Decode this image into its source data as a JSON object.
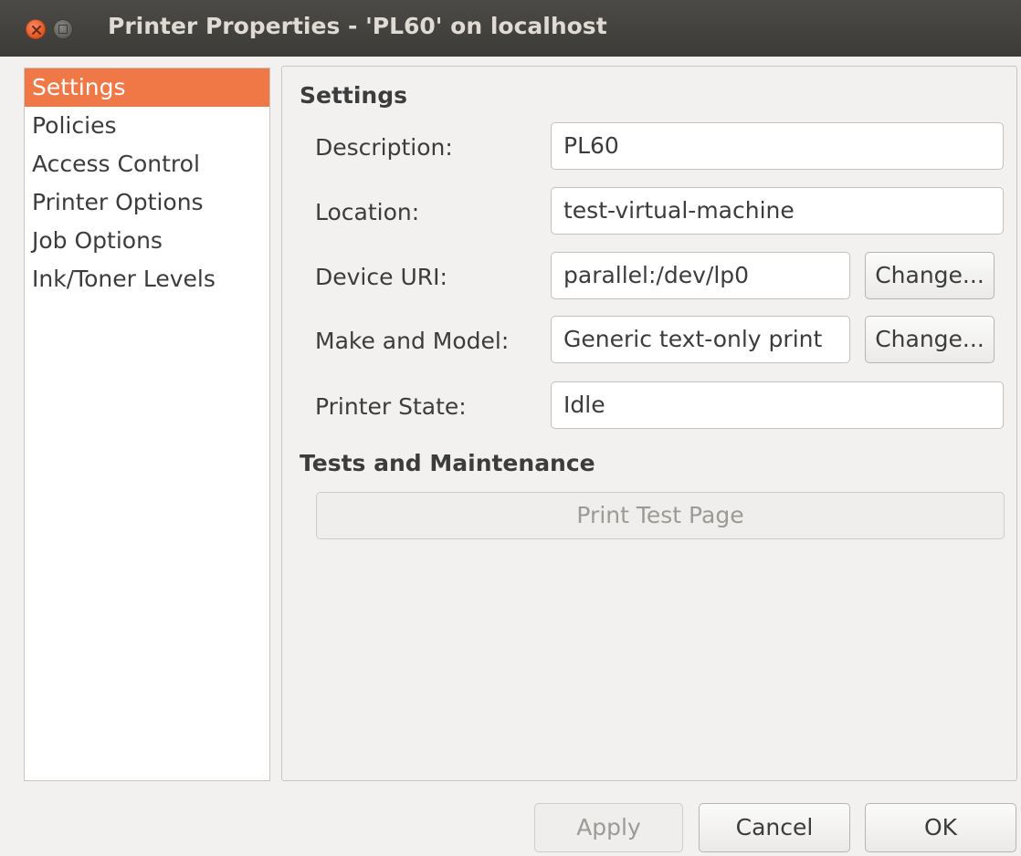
{
  "window": {
    "title": "Printer Properties - 'PL60' on localhost"
  },
  "sidebar": {
    "items": [
      {
        "label": "Settings",
        "active": true
      },
      {
        "label": "Policies",
        "active": false
      },
      {
        "label": "Access Control",
        "active": false
      },
      {
        "label": "Printer Options",
        "active": false
      },
      {
        "label": "Job Options",
        "active": false
      },
      {
        "label": "Ink/Toner Levels",
        "active": false
      }
    ]
  },
  "settings": {
    "heading": "Settings",
    "description": {
      "label": "Description:",
      "value": "PL60"
    },
    "location": {
      "label": "Location:",
      "value": "test-virtual-machine"
    },
    "device_uri": {
      "label": "Device URI:",
      "value": "parallel:/dev/lp0",
      "change_label": "Change..."
    },
    "make_model": {
      "label": "Make and Model:",
      "value": "Generic text-only print",
      "change_label": "Change..."
    },
    "printer_state": {
      "label": "Printer State:",
      "value": "Idle"
    }
  },
  "tests": {
    "heading": "Tests and Maintenance",
    "print_test_label": "Print Test Page"
  },
  "footer": {
    "apply_label": "Apply",
    "cancel_label": "Cancel",
    "ok_label": "OK"
  },
  "colors": {
    "accent": "#f07746",
    "titlebar": "#3c3b37",
    "close_button": "#e2561f"
  },
  "icons": {
    "close": "close-icon",
    "minimize": "minimize-icon"
  }
}
